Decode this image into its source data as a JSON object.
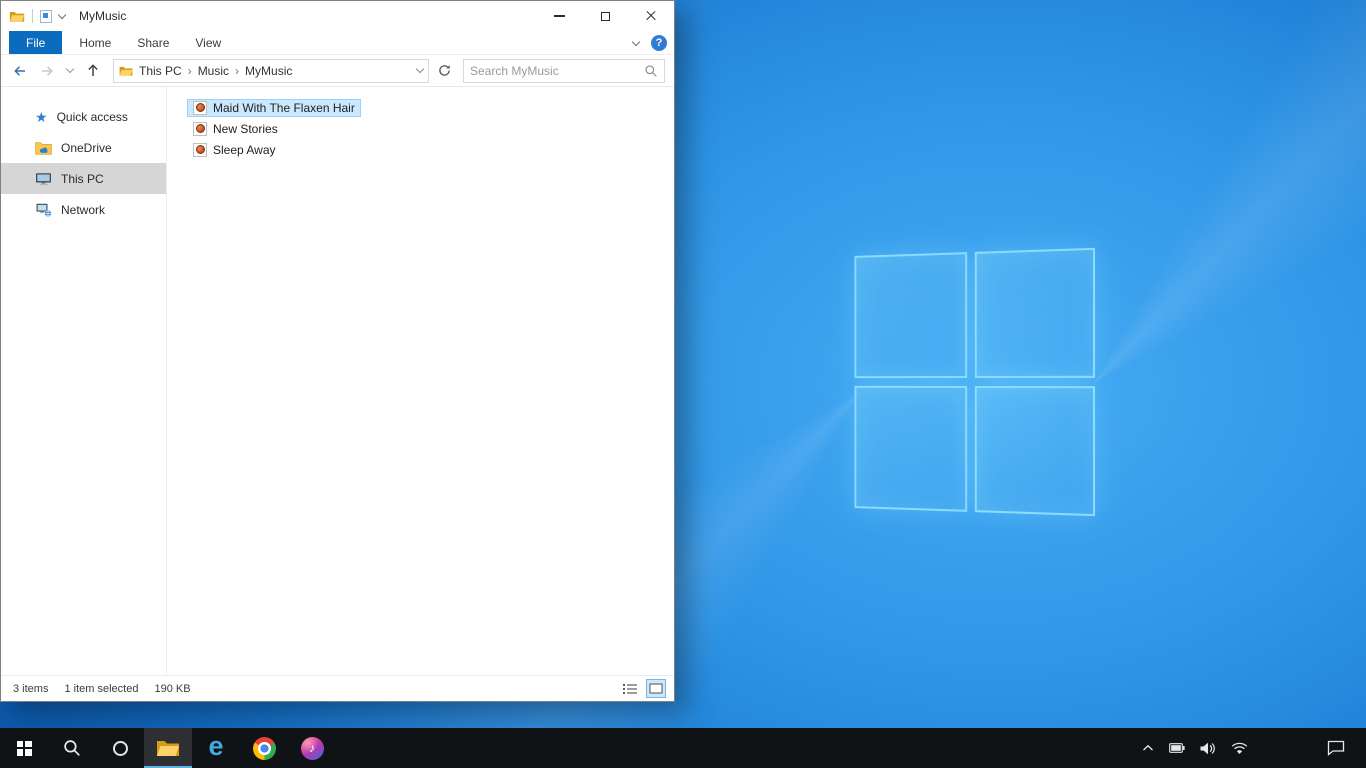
{
  "explorer": {
    "window_title": "MyMusic",
    "tabs": [
      {
        "label": "File",
        "active": true
      },
      {
        "label": "Home",
        "active": false
      },
      {
        "label": "Share",
        "active": false
      },
      {
        "label": "View",
        "active": false
      }
    ],
    "help_glyph": "?",
    "breadcrumb": {
      "separator": "›",
      "items": [
        {
          "label": "This PC"
        },
        {
          "label": "Music"
        },
        {
          "label": "MyMusic"
        }
      ]
    },
    "search": {
      "placeholder": "Search MyMusic"
    },
    "sidebar": {
      "items": [
        {
          "label": "Quick access",
          "icon": "quick-access-star",
          "selected": false
        },
        {
          "label": "OneDrive",
          "icon": "onedrive-folder",
          "selected": false
        },
        {
          "label": "This PC",
          "icon": "this-pc-monitor",
          "selected": true
        },
        {
          "label": "Network",
          "icon": "network-computer",
          "selected": false
        }
      ]
    },
    "files": [
      {
        "name": "Maid With The Flaxen Hair",
        "icon": "audio-file",
        "selected": true
      },
      {
        "name": "New Stories",
        "icon": "audio-file",
        "selected": false
      },
      {
        "name": "Sleep Away",
        "icon": "audio-file",
        "selected": false
      }
    ],
    "status": {
      "count": "3 items",
      "selected": "1 item selected",
      "size": "190 KB"
    }
  },
  "taskbar": {
    "apps": [
      "start",
      "search",
      "cortana",
      "file-explorer",
      "edge",
      "chrome",
      "itunes"
    ],
    "active_app": "file-explorer",
    "edge_glyph": "e",
    "itunes_glyph": "♪",
    "tray": [
      "tray-expand",
      "battery",
      "volume",
      "network",
      "action-center"
    ]
  },
  "desktop": {
    "wallpaper": "windows-10-default-blue"
  },
  "colors": {
    "accent_blue": "#0b6bbd",
    "selection_bg": "#cce8ff",
    "selection_border": "#99d1ff",
    "sidebar_selected": "#d6d6d6",
    "taskbar_bg": "#101316"
  }
}
